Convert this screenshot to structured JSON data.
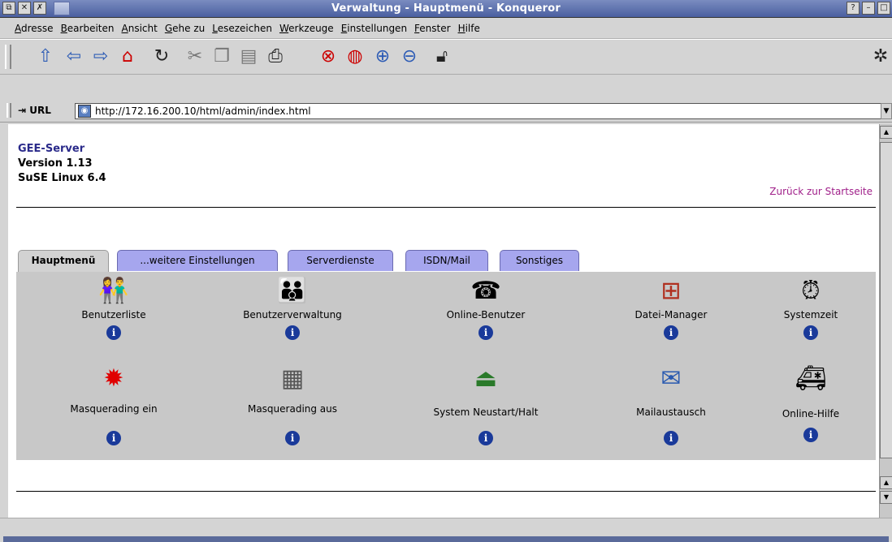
{
  "window": {
    "title": "Verwaltung - Hauptmenü - Konqueror"
  },
  "menu": [
    "Adresse",
    "Bearbeiten",
    "Ansicht",
    "Gehe zu",
    "Lesezeichen",
    "Werkzeuge",
    "Einstellungen",
    "Fenster",
    "Hilfe"
  ],
  "url": {
    "label": "URL",
    "value": "http://172.16.200.10/html/admin/index.html"
  },
  "server": {
    "name": "GEE-Server",
    "version": "Version 1.13",
    "os": "SuSE Linux 6.4"
  },
  "back_link": "Zurück zur Startseite",
  "tabs": [
    "Hauptmenü",
    "...weitere Einstellungen",
    "Serverdienste",
    "ISDN/Mail",
    "Sonstiges"
  ],
  "items_row1": [
    "Benutzerliste",
    "Benutzerverwaltung",
    "Online-Benutzer",
    "Datei-Manager",
    "Systemzeit"
  ],
  "items_row2": [
    "Masquerading ein",
    "Masquerading aus",
    "System Neustart/Halt",
    "Mailaustausch",
    "Online-Hilfe"
  ],
  "info_glyph": "i"
}
